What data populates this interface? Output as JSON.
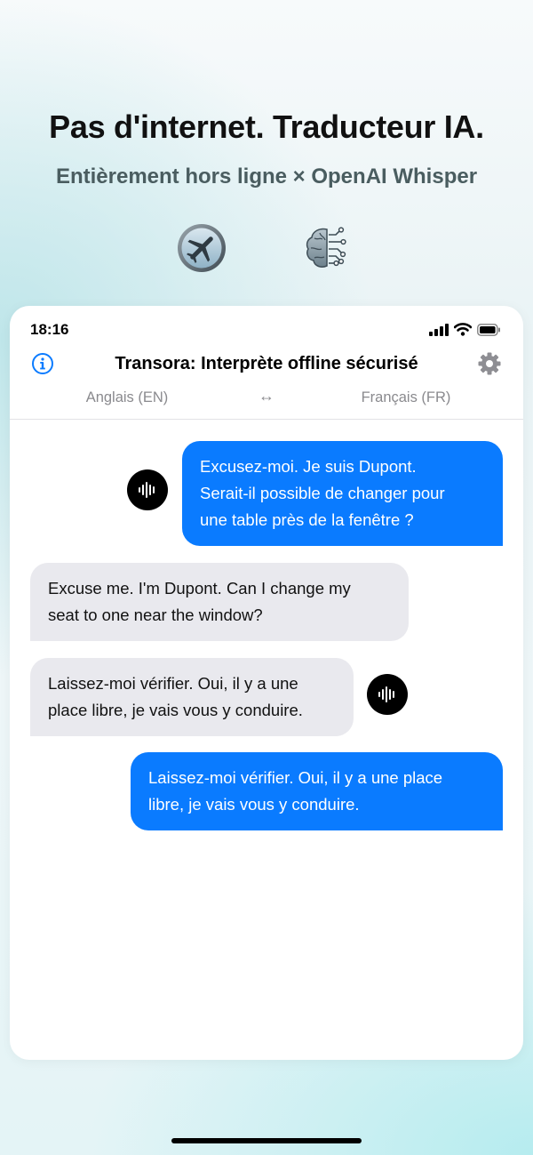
{
  "promo": {
    "headline": "Pas d'internet. Traducteur IA.",
    "subheadline": "Entièrement hors ligne × OpenAI Whisper",
    "icons": [
      "airplane-mode-icon",
      "ai-brain-icon"
    ]
  },
  "status_bar": {
    "time": "18:16",
    "icons": [
      "cellular-signal-icon",
      "wifi-icon",
      "battery-icon"
    ]
  },
  "nav": {
    "title": "Transora: Interprète offline sécurisé",
    "left_icon": "info-icon",
    "right_icon": "gear-icon"
  },
  "languages": {
    "source": "Anglais (EN)",
    "swap": "↔",
    "target": "Français (FR)"
  },
  "messages": [
    {
      "side": "right",
      "lines": [
        "Excusez-moi. Je suis Dupont.",
        "Serait-il possible de changer pour",
        "une table près de la fenêtre ?"
      ],
      "has_voice_button": true
    },
    {
      "side": "left",
      "lines": [
        "Excuse me. I'm Dupont. Can I change my",
        "seat to one near the window?"
      ],
      "has_voice_button": false
    },
    {
      "side": "left",
      "lines": [
        "Laissez-moi vérifier. Oui, il y a une",
        "place libre, je vais vous y conduire."
      ],
      "has_voice_button": true
    },
    {
      "side": "right",
      "lines": [
        "Laissez-moi vérifier. Oui, il y a une place",
        "libre, je vais vous y conduire."
      ],
      "has_voice_button": false
    }
  ],
  "colors": {
    "accent": "#0a7bff",
    "incoming_bubble": "#e9e9ee",
    "secondary_text": "#8a8a8e"
  }
}
